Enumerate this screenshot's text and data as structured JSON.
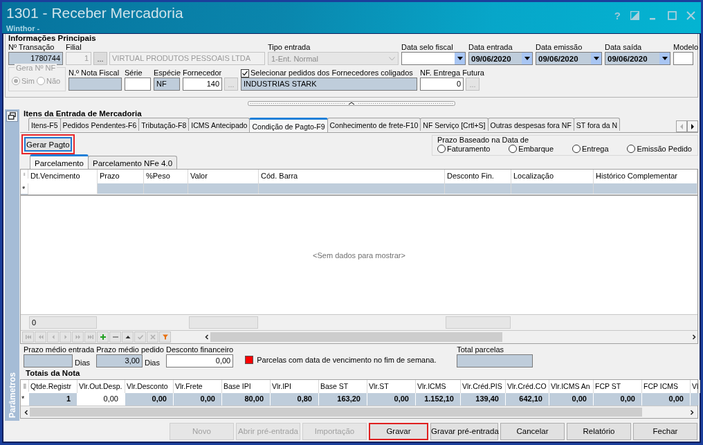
{
  "window": {
    "title": "1301 - Receber Mercadoria",
    "subtitle": "Winthor -",
    "help": "?"
  },
  "main_info": {
    "title": "Informações Principais",
    "top_fields": [
      {
        "label": "Nº Transação",
        "parts": [
          {
            "kind": "readonly",
            "value": "1780744",
            "numeric": true
          }
        ]
      },
      {
        "label": "Filial",
        "parts": [
          {
            "kind": "disabled",
            "value": "1",
            "numeric": true
          },
          {
            "kind": "button",
            "text": "...",
            "disabled": false
          },
          {
            "kind": "disabled",
            "value": "VIRTUAL PRODUTOS PESSOAIS LTDA"
          }
        ]
      },
      {
        "label": "Tipo entrada",
        "parts": [
          {
            "kind": "dropdown",
            "value": "1-Ent. Normal",
            "disabled": true
          }
        ]
      },
      {
        "label": "Data selo fiscal",
        "parts": [
          {
            "kind": "date",
            "readonly": false
          }
        ]
      },
      {
        "label": "Data entrada",
        "parts": [
          {
            "kind": "date",
            "value": "09/06/2020",
            "readonly": true
          }
        ]
      },
      {
        "label": "Data emissão",
        "parts": [
          {
            "kind": "date",
            "value": "09/06/2020",
            "readonly": true
          }
        ]
      },
      {
        "label": "Data saída",
        "parts": [
          {
            "kind": "date",
            "value": "09/06/2020",
            "readonly": true
          }
        ]
      },
      {
        "label": "Modelo",
        "parts": [
          {
            "kind": "input"
          }
        ]
      }
    ],
    "bottom_fields": [
      {
        "kind": "radiogroup",
        "label": "Gera Nº NF",
        "disabled": true,
        "options": [
          {
            "label": "Sim",
            "selected": true
          },
          {
            "label": "Não",
            "selected": false
          }
        ]
      },
      {
        "label": "N.º Nota Fiscal",
        "parts": [
          {
            "kind": "readonly"
          }
        ]
      },
      {
        "label": "Série",
        "parts": [
          {
            "kind": "input"
          }
        ]
      },
      {
        "label": "Espécie",
        "parts": [
          {
            "kind": "readonly",
            "value": "NF"
          }
        ]
      },
      {
        "label": "Fornecedor",
        "parts": [
          {
            "kind": "input",
            "value": "140",
            "numeric": true
          },
          {
            "kind": "button",
            "text": "...",
            "disabled": true
          }
        ]
      },
      {
        "label": "Selecionar pedidos dos Fornecedores coligados",
        "checked": true,
        "parts": [
          {
            "kind": "readonly",
            "value": "INDUSTRIAS STARK"
          }
        ]
      },
      {
        "label": "NF. Entrega Futura",
        "parts": [
          {
            "kind": "input",
            "value": "0",
            "numeric": true
          },
          {
            "kind": "button",
            "text": "...",
            "disabled": true
          }
        ]
      }
    ]
  },
  "items": {
    "title": "Itens da Entrada de Mercadoria",
    "side_label": "Parâmetros",
    "tabs": [
      {
        "label": "Itens-F5",
        "selected": false
      },
      {
        "label": "Pedidos Pendentes-F6",
        "selected": false
      },
      {
        "label": "Tributação-F8",
        "selected": false
      },
      {
        "label": "ICMS Antecipado",
        "selected": false
      },
      {
        "label": "Condição de Pagto-F9",
        "selected": true
      },
      {
        "label": "Conhecimento de frete-F10",
        "selected": false
      },
      {
        "label": "NF Serviço [Crtl+S]",
        "selected": false
      },
      {
        "label": "Outras despesas fora NF",
        "selected": false
      },
      {
        "label": "ST fora da N",
        "selected": false
      }
    ],
    "generate_button": {
      "label": "Gerar Pagto",
      "highlighted": true
    },
    "term_base": {
      "title": "Prazo Baseado na Data de",
      "options": [
        {
          "label": "Faturamento",
          "selected": false
        },
        {
          "label": "Embarque",
          "selected": false
        },
        {
          "label": "Entrega",
          "selected": false
        },
        {
          "label": "Emissão Pedido",
          "selected": false
        }
      ]
    },
    "subtabs": [
      {
        "label": "Parcelamento",
        "selected": true
      },
      {
        "label": "Parcelamento NFe 4.0",
        "selected": false
      }
    ],
    "grid": {
      "columns": [
        {
          "label": "Dt.Vencimento",
          "editable": true,
          "footer": true,
          "footer_value": "0"
        },
        {
          "label": "Prazo",
          "editable": false
        },
        {
          "label": "%Peso",
          "editable": false
        },
        {
          "label": "Valor",
          "editable": false,
          "footer": true
        },
        {
          "label": "Cód. Barra",
          "editable": false
        },
        {
          "label": "Desconto Fin.",
          "editable": false,
          "footer": true
        },
        {
          "label": "Localização",
          "editable": false
        },
        {
          "label": "Histórico Complementar",
          "editable": false
        }
      ],
      "new_row_marker": "*",
      "empty_text": "<Sem dados para mostrar>",
      "navigator": [
        {
          "kind": "first",
          "disabled": true
        },
        {
          "kind": "prev-page",
          "disabled": true
        },
        {
          "kind": "prev",
          "disabled": true
        },
        {
          "kind": "next",
          "disabled": true
        },
        {
          "kind": "next-page",
          "disabled": true
        },
        {
          "kind": "last",
          "disabled": true
        },
        {
          "kind": "add",
          "disabled": false
        },
        {
          "kind": "delete",
          "disabled": false
        },
        {
          "kind": "edit",
          "disabled": false
        },
        {
          "kind": "post",
          "disabled": true
        },
        {
          "kind": "cancel",
          "disabled": true
        },
        {
          "kind": "filter",
          "disabled": false
        }
      ]
    },
    "params": [
      {
        "label": "Prazo médio entrada",
        "kind": "readonly",
        "unit": "Dias"
      },
      {
        "label": "Prazo médio pedido",
        "kind": "readonly",
        "value": "3,00",
        "unit": "Dias"
      },
      {
        "label": "Desconto financeiro",
        "kind": "input",
        "value": "0,00"
      }
    ],
    "legend": {
      "color": "#ff0000",
      "text": "Parcelas com data de vencimento no fim de semana."
    },
    "total_installments": {
      "label": "Total parcelas"
    },
    "totals": {
      "title": "Totais da Nota",
      "new_row_marker": "*",
      "columns": [
        {
          "label": "Qtde.Registr",
          "value": "1",
          "editable": false
        },
        {
          "label": "Vlr.Out.Desp.",
          "value": "0,00",
          "editable": true
        },
        {
          "label": "Vlr.Desconto",
          "value": "0,00",
          "editable": false
        },
        {
          "label": "Vlr.Frete",
          "value": "0,00",
          "editable": false
        },
        {
          "label": "Base IPI",
          "value": "80,00",
          "editable": false
        },
        {
          "label": "Vlr.IPI",
          "value": "0,80",
          "editable": false
        },
        {
          "label": "Base ST",
          "value": "163,20",
          "editable": false
        },
        {
          "label": "Vlr.ST",
          "value": "0,00",
          "editable": false
        },
        {
          "label": "Vlr.ICMS",
          "value": "1.152,10",
          "editable": false
        },
        {
          "label": "Vlr.Créd.PIS",
          "value": "139,40",
          "editable": false
        },
        {
          "label": "Vlr.Créd.CO",
          "value": "642,10",
          "editable": false
        },
        {
          "label": "Vlr.ICMS An",
          "value": "0,00",
          "editable": false
        },
        {
          "label": "FCP ST",
          "value": "0,00",
          "editable": false
        },
        {
          "label": "FCP ICMS",
          "value": "0,00",
          "editable": false
        },
        {
          "label": "Vl",
          "editable": false
        }
      ]
    }
  },
  "buttons": [
    {
      "label": "Novo",
      "disabled": true,
      "highlighted": false
    },
    {
      "label": "Abrir pré-entrada",
      "disabled": true,
      "highlighted": false
    },
    {
      "label": "Importação",
      "disabled": true,
      "highlighted": false
    },
    {
      "label": "Gravar",
      "disabled": false,
      "highlighted": true
    },
    {
      "label": "Gravar pré-entrada",
      "disabled": false,
      "highlighted": false
    },
    {
      "label": "Cancelar",
      "disabled": false,
      "highlighted": false
    },
    {
      "label": "Relatório",
      "disabled": false,
      "highlighted": false
    },
    {
      "label": "Fechar",
      "disabled": false,
      "highlighted": false
    }
  ]
}
